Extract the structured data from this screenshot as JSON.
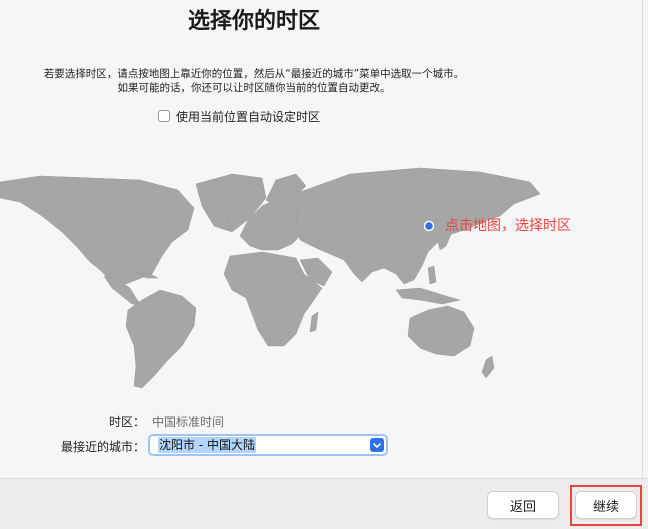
{
  "header": {
    "title": "选择你的时区"
  },
  "instructions": {
    "line1": "若要选择时区，请点按地图上靠近你的位置，然后从“最接近的城市”菜单中选取一个城市。",
    "line2": "如果可能的话，你还可以让时区随你当前的位置自动更改。"
  },
  "auto_timezone": {
    "label": "使用当前位置自动设定时区",
    "checked": false
  },
  "map": {
    "land_color": "#a6a6a6",
    "marker_color": "#2c72e4"
  },
  "annotation": {
    "text": "点击地图，选择时区",
    "color": "#e8433f"
  },
  "timezone": {
    "label": "时区：",
    "value": "中国标准时间"
  },
  "closest_city": {
    "label": "最接近的城市：",
    "value": "沈阳市 - 中国大陆"
  },
  "footer": {
    "back_label": "返回",
    "continue_label": "继续"
  }
}
